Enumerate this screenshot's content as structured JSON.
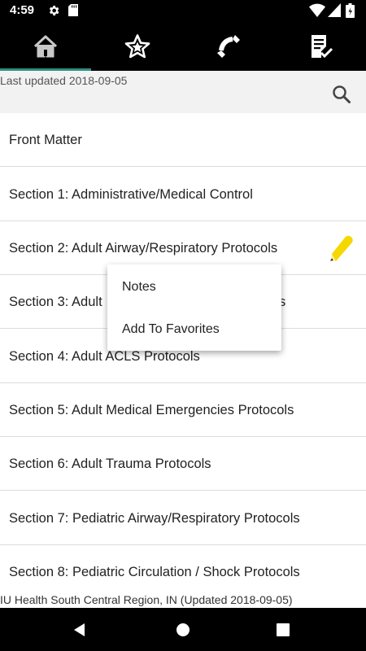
{
  "status_bar": {
    "time": "4:59",
    "icons": [
      "gear-icon",
      "sd-card-icon",
      "wifi-icon",
      "signal-icon",
      "battery-icon"
    ]
  },
  "tabs": [
    {
      "name": "home",
      "icon": "home-icon",
      "selected": true
    },
    {
      "name": "favorites",
      "icon": "star-icon",
      "selected": false
    },
    {
      "name": "contacts",
      "icon": "phone-icon",
      "selected": false
    },
    {
      "name": "checklist",
      "icon": "checklist-icon",
      "selected": false
    }
  ],
  "header": {
    "last_updated": "Last updated 2018-09-05",
    "search_icon": "search-icon"
  },
  "list": {
    "items": [
      {
        "label": "Front Matter"
      },
      {
        "label": "Section 1: Administrative/Medical Control"
      },
      {
        "label": "Section 2: Adult Airway/Respiratory Protocols",
        "has_note": true
      },
      {
        "label": "Section 3: Adult",
        "trailing": "s"
      },
      {
        "label": "Section 4: Adult ACLS Protocols"
      },
      {
        "label": "Section 5: Adult Medical Emergencies Protocols"
      },
      {
        "label": "Section 6: Adult Trauma Protocols"
      },
      {
        "label": "Section 7: Pediatric Airway/Respiratory Protocols"
      },
      {
        "label": "Section 8: Pediatric Circulation / Shock Protocols"
      }
    ]
  },
  "context_menu": {
    "items": [
      "Notes",
      "Add To Favorites"
    ]
  },
  "footer": {
    "text": "IU Health South Central Region, IN (Updated 2018-09-05)"
  },
  "colors": {
    "tab_indicator": "#2f8d7f",
    "note_pencil": "#f5d800",
    "background": "#ffffff",
    "header_bg": "#f2f2f2"
  }
}
